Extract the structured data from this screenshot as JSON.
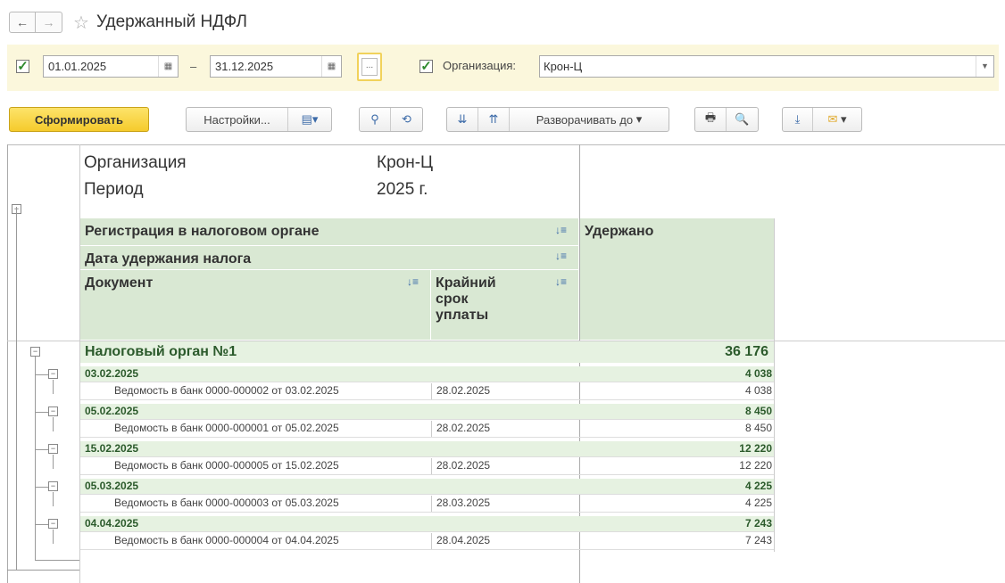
{
  "window": {
    "title": "Удержанный НДФЛ",
    "back_icon": "arrow-left-icon",
    "forward_icon": "arrow-right-icon",
    "favorite_icon": "star-icon"
  },
  "filters": {
    "date_from": "01.01.2025",
    "date_separator": "–",
    "date_to": "31.12.2025",
    "more_label": "...",
    "org_label": "Организация:",
    "org_value": "Крон-Ц"
  },
  "toolbar": {
    "generate": "Сформировать",
    "settings": "Настройки...",
    "expand_to": "Разворачивать до"
  },
  "report": {
    "org_caption": "Организация",
    "org_value": "Крон-Ц",
    "period_caption": "Период",
    "period_value": "2025 г.",
    "col_registration": "Регистрация в налоговом органе",
    "col_date": "Дата удержания налога",
    "col_document": "Документ",
    "col_deadline": "Крайний срок уплаты",
    "col_withheld": "Удержано",
    "top_group": {
      "label": "Налоговый орган №1",
      "value": "36 176"
    },
    "groups": [
      {
        "date": "03.02.2025",
        "total": "4 038",
        "doc": "Ведомость в банк 0000-000002 от 03.02.2025",
        "deadline": "28.02.2025",
        "value": "4 038"
      },
      {
        "date": "05.02.2025",
        "total": "8 450",
        "doc": "Ведомость в банк 0000-000001 от 05.02.2025",
        "deadline": "28.02.2025",
        "value": "8 450"
      },
      {
        "date": "15.02.2025",
        "total": "12 220",
        "doc": "Ведомость в банк 0000-000005 от 15.02.2025",
        "deadline": "28.02.2025",
        "value": "12 220"
      },
      {
        "date": "05.03.2025",
        "total": "4 225",
        "doc": "Ведомость в банк 0000-000003 от 05.03.2025",
        "deadline": "28.03.2025",
        "value": "4 225"
      },
      {
        "date": "04.04.2025",
        "total": "7 243",
        "doc": "Ведомость в банк 0000-000004 от 04.04.2025",
        "deadline": "28.04.2025",
        "value": "7 243"
      }
    ]
  }
}
